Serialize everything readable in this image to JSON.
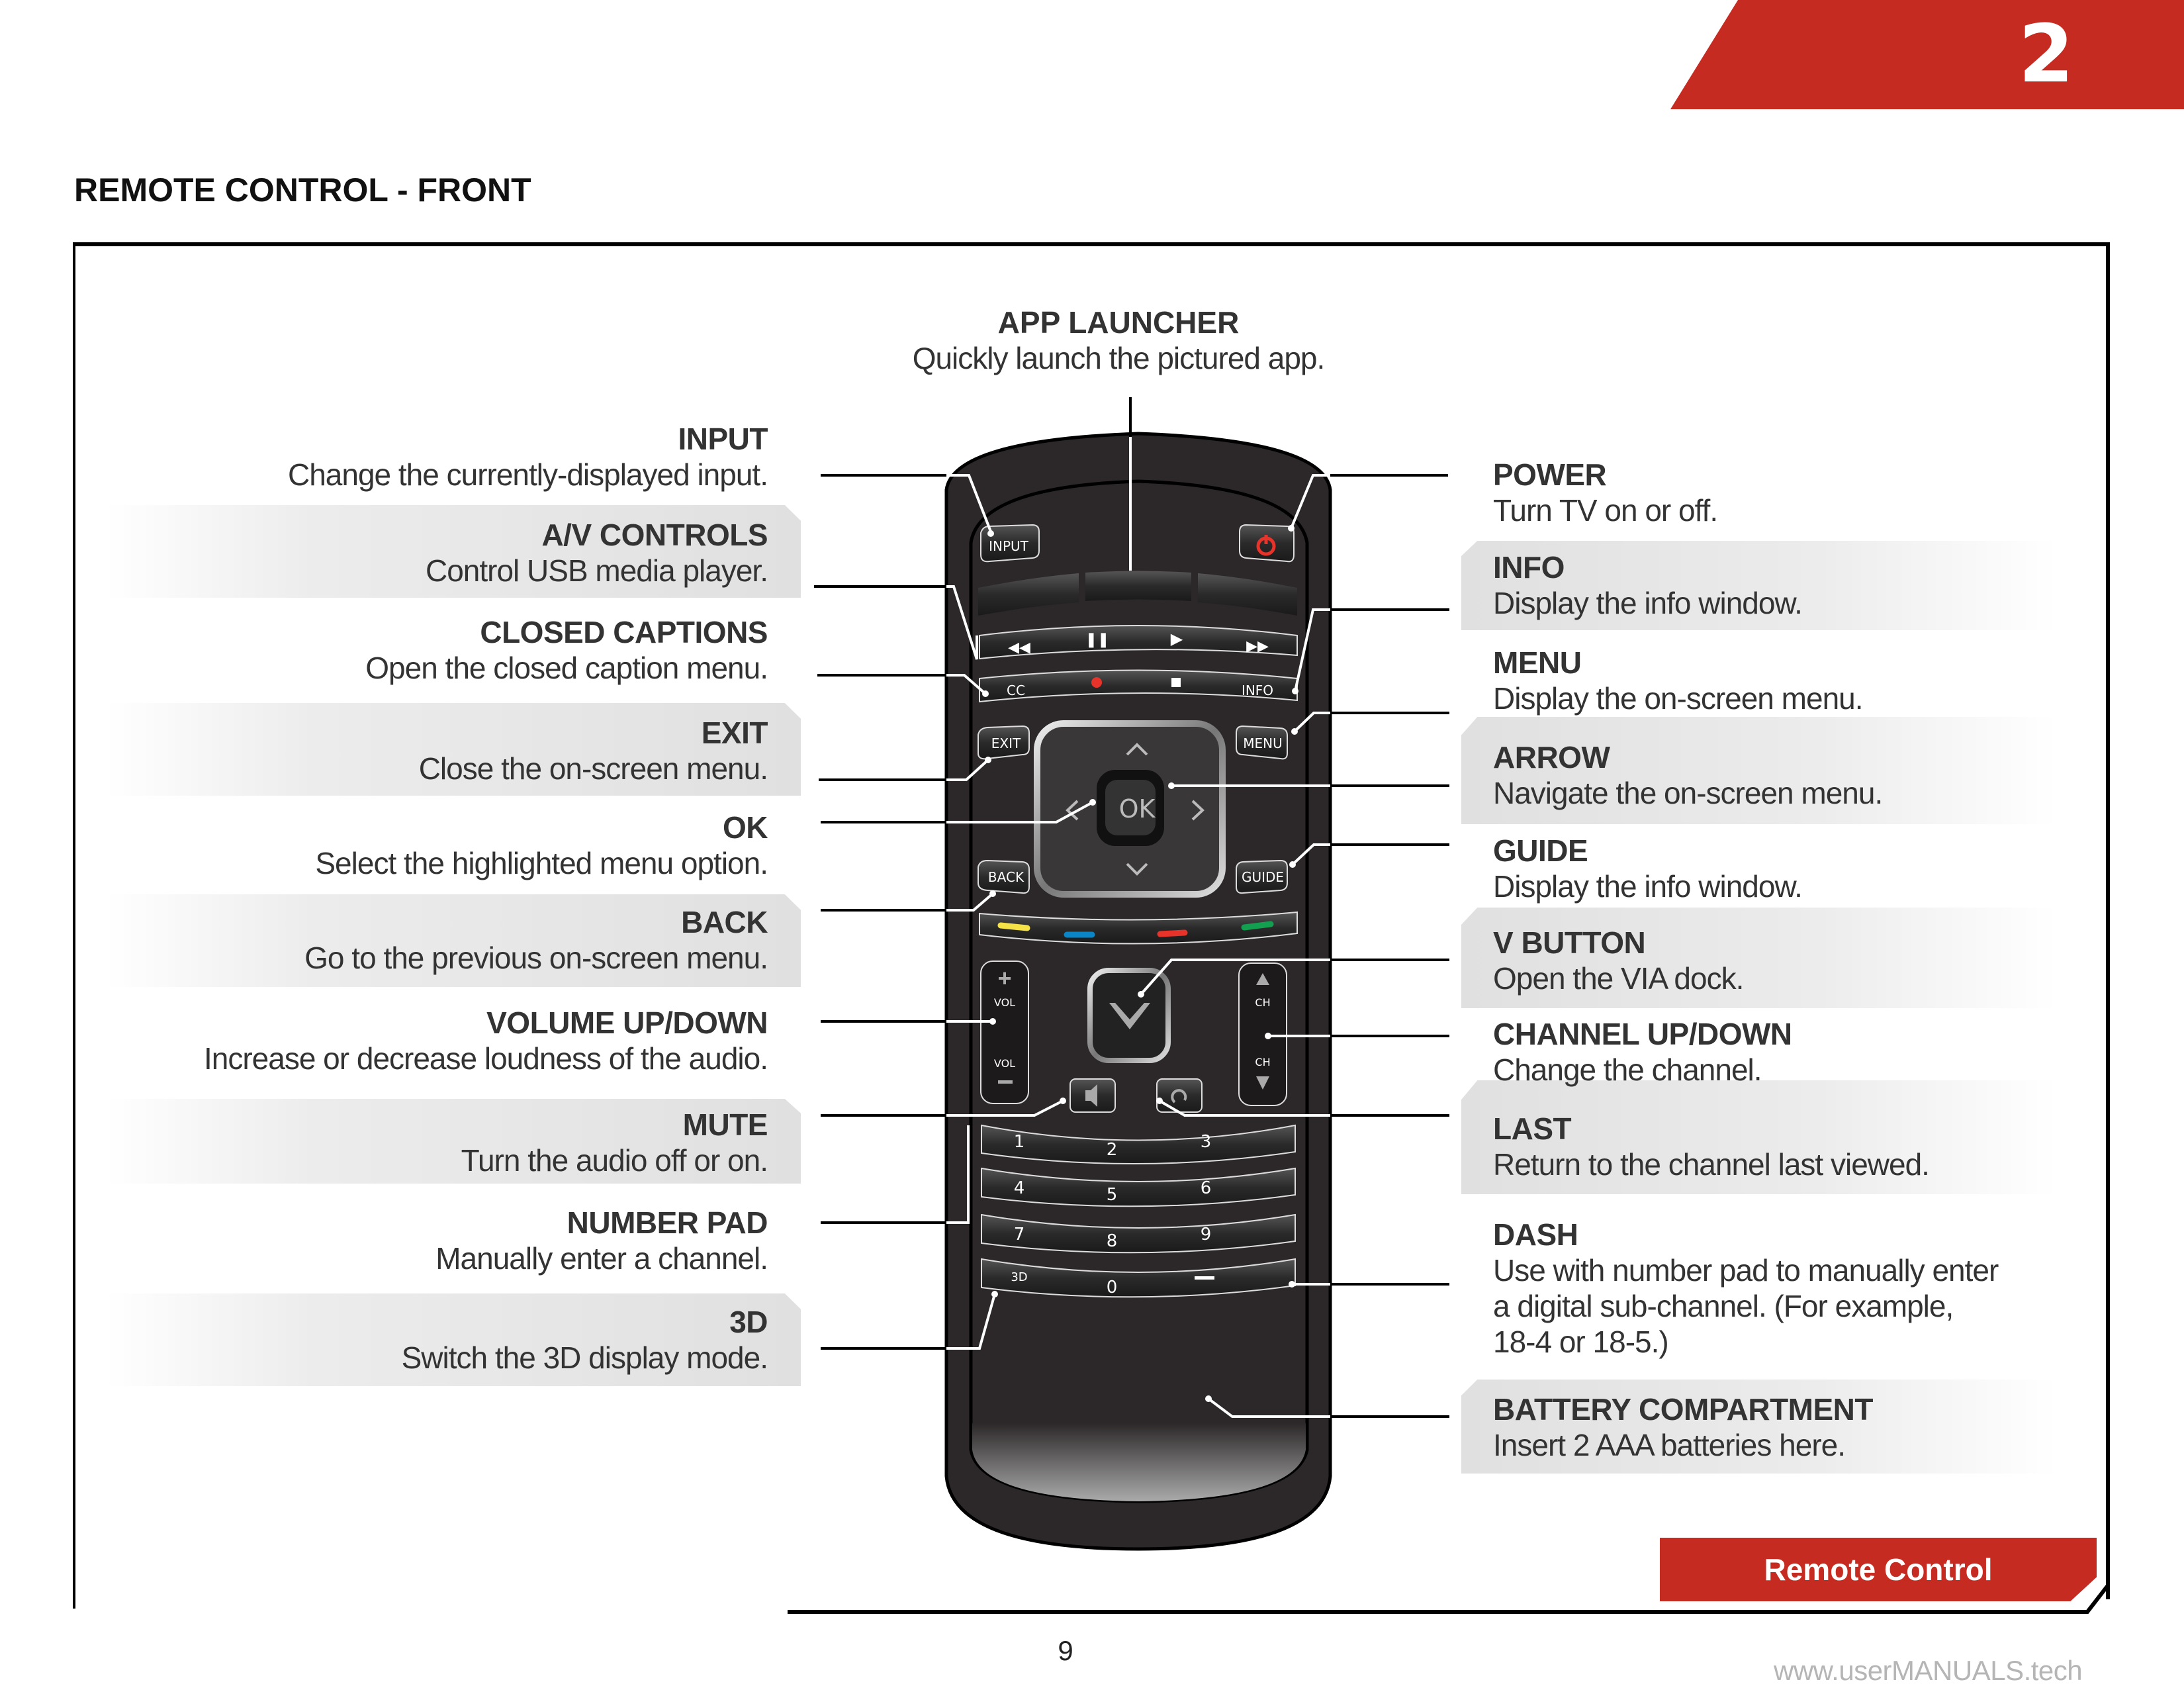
{
  "chapter": {
    "number": "2",
    "accent_color": "#c62b22"
  },
  "page_title": "REMOTE CONTROL - FRONT",
  "app_launcher": {
    "name": "APP LAUNCHER",
    "desc": "Quickly launch the pictured app."
  },
  "left_callouts": [
    {
      "name": "INPUT",
      "desc": "Change the currently-displayed input.",
      "shaded": false
    },
    {
      "name": "A/V CONTROLS",
      "desc": "Control USB media player.",
      "shaded": true
    },
    {
      "name": "CLOSED CAPTIONS",
      "desc": "Open the closed caption menu.",
      "shaded": false
    },
    {
      "name": "EXIT",
      "desc": "Close the on-screen menu.",
      "shaded": true
    },
    {
      "name": "OK",
      "desc": "Select the highlighted menu option.",
      "shaded": false
    },
    {
      "name": "BACK",
      "desc": "Go to the previous on-screen menu.",
      "shaded": true
    },
    {
      "name": "VOLUME UP/DOWN",
      "desc": "Increase or decrease loudness of the audio.",
      "shaded": false
    },
    {
      "name": "MUTE",
      "desc": "Turn the audio off or on.",
      "shaded": true
    },
    {
      "name": "NUMBER PAD",
      "desc": "Manually enter a channel.",
      "shaded": false
    },
    {
      "name": "3D",
      "desc": "Switch the 3D display mode.",
      "shaded": true
    }
  ],
  "right_callouts": [
    {
      "name": "POWER",
      "desc": "Turn TV on or off.",
      "shaded": false
    },
    {
      "name": "INFO",
      "desc": "Display the info window.",
      "shaded": true
    },
    {
      "name": "MENU",
      "desc": "Display the on-screen menu.",
      "shaded": false
    },
    {
      "name": "ARROW",
      "desc": "Navigate the on-screen menu.",
      "shaded": true
    },
    {
      "name": "GUIDE",
      "desc": "Display the info window.",
      "shaded": false
    },
    {
      "name": "V BUTTON",
      "desc": "Open the VIA dock.",
      "shaded": true
    },
    {
      "name": "CHANNEL UP/DOWN",
      "desc": "Change the channel.",
      "shaded": false
    },
    {
      "name": "LAST",
      "desc": "Return to the channel last viewed.",
      "shaded": true
    },
    {
      "name": "DASH",
      "desc_lines": [
        "Use with number pad to manually enter",
        "a digital sub-channel. (For example,",
        "18-4 or 18-5.)"
      ],
      "shaded": false
    },
    {
      "name": "BATTERY COMPARTMENT",
      "desc": "Insert 2 AAA batteries here.",
      "shaded": true
    }
  ],
  "remote": {
    "buttons": {
      "input": "INPUT",
      "cc": "CC",
      "info": "INFO",
      "exit": "EXIT",
      "menu": "MENU",
      "ok": "OK",
      "back": "BACK",
      "guide": "GUIDE",
      "vol": "VOL",
      "ch": "CH",
      "three_d": "3D",
      "digits": [
        "1",
        "2",
        "3",
        "4",
        "5",
        "6",
        "7",
        "8",
        "9",
        "0"
      ]
    },
    "colors": {
      "body": "#2c2829",
      "power": "#e8332a",
      "record": "#e8332a",
      "color_keys": [
        "#f4e246",
        "#0a85c8",
        "#e8332a",
        "#12a050"
      ]
    }
  },
  "section_badge": "Remote Control",
  "page_number": "9",
  "watermark": "www.userMANUALS.tech"
}
